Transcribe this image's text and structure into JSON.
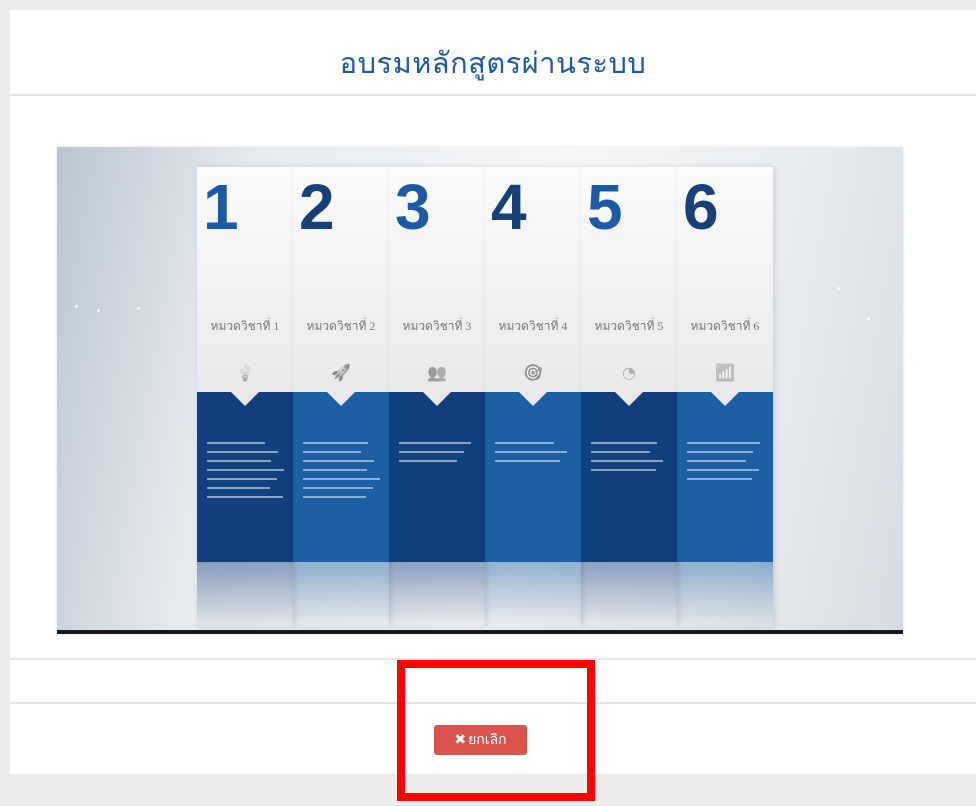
{
  "modal": {
    "title": "อบรมหลักสูตรผ่านระบบ",
    "cancel_label": "ยกเลิก",
    "cancel_icon": "close-icon",
    "cancel_color": "#d9534f",
    "highlight_color": "#ff0000"
  },
  "video": {
    "cards": [
      {
        "number": "1",
        "label": "หมวดวิชาที่ 1",
        "icon": "lightbulb-icon",
        "number_color": "#1d5aa6",
        "panel_color": "#123f7d"
      },
      {
        "number": "2",
        "label": "หมวดวิชาที่ 2",
        "icon": "rocket-icon",
        "number_color": "#173f78",
        "panel_color": "#1d5fa5"
      },
      {
        "number": "3",
        "label": "หมวดวิชาที่ 3",
        "icon": "people-icon",
        "number_color": "#1d5aa6",
        "panel_color": "#123f7d"
      },
      {
        "number": "4",
        "label": "หมวดวิชาที่ 4",
        "icon": "target-icon",
        "number_color": "#173f78",
        "panel_color": "#1d5fa5"
      },
      {
        "number": "5",
        "label": "หมวดวิชาที่ 5",
        "icon": "pie-chart-icon",
        "number_color": "#1d5aa6",
        "panel_color": "#123f7d"
      },
      {
        "number": "6",
        "label": "หมวดวิชาที่ 6",
        "icon": "bar-chart-icon",
        "number_color": "#173f78",
        "panel_color": "#1d5fa5"
      }
    ]
  }
}
